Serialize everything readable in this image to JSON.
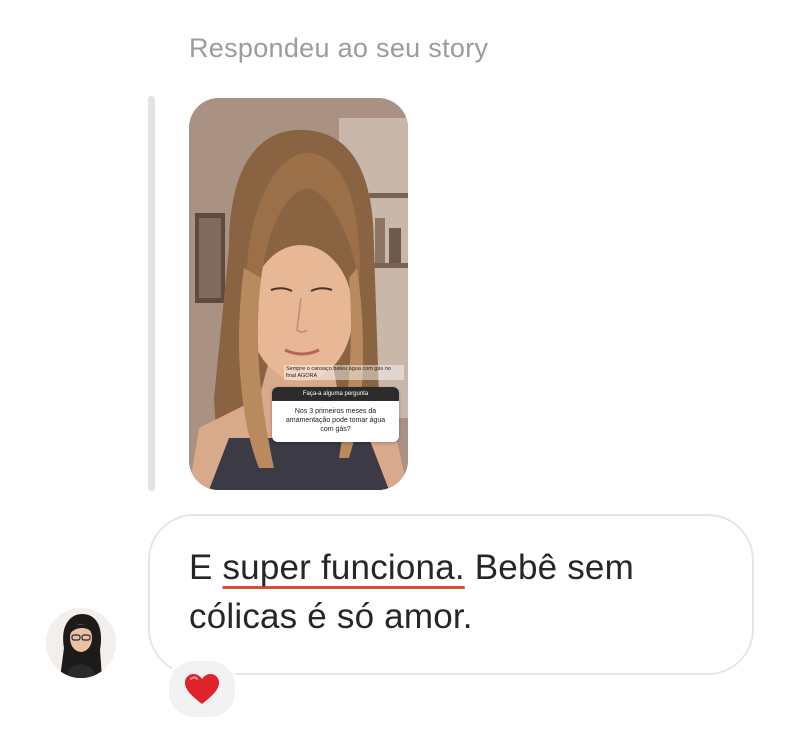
{
  "story_reply": {
    "caption": "Respondeu ao seu story",
    "story": {
      "overlay_text": "Sempre o cansaço bateu água com gás no final AGORA",
      "question_header": "Faça-a alguma pergunta",
      "question_text": "Nos 3 primeiros meses da amamentação pode tomar água com gás?"
    }
  },
  "message": {
    "prefix": "E ",
    "highlight": "super funciona.",
    "suffix": " Bebê sem cólicas é só amor.",
    "underline_color": "#e04a3b"
  },
  "reaction": {
    "emoji": "heart-icon",
    "color": "#e0232b"
  }
}
